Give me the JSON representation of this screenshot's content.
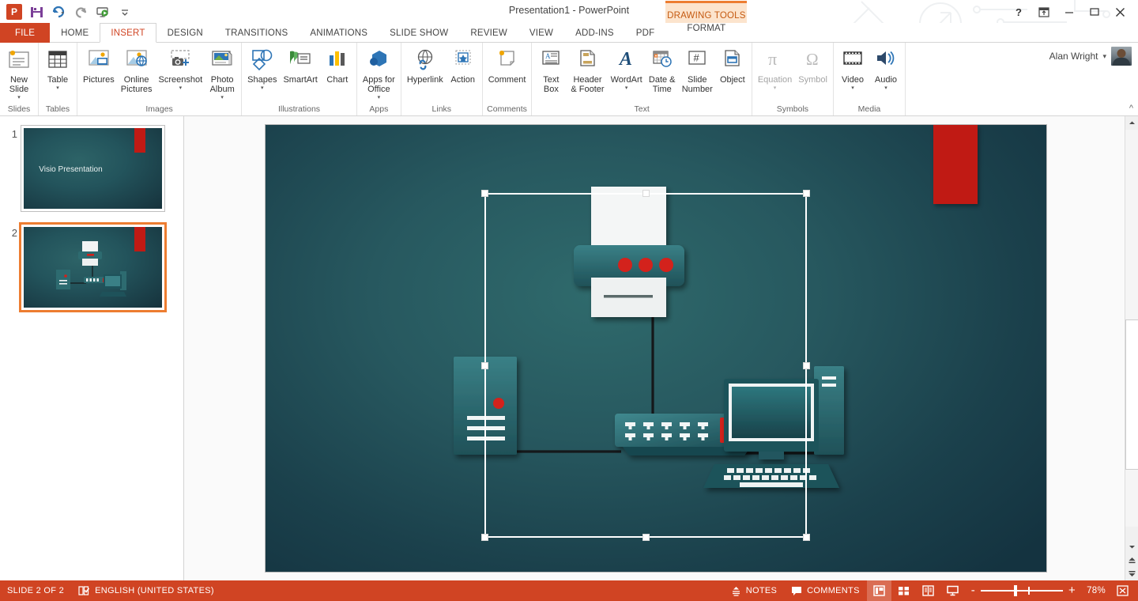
{
  "window": {
    "title": "Presentation1 - PowerPoint",
    "help_icon": "?",
    "ribbon_display_icon": "ribbon-display-options",
    "minimize_icon": "minimize",
    "maximize_icon": "maximize",
    "close_icon": "close"
  },
  "quick_access": {
    "app_logo": "P",
    "items": [
      {
        "name": "save-icon",
        "label": "Save"
      },
      {
        "name": "undo-icon",
        "label": "Undo"
      },
      {
        "name": "redo-icon",
        "label": "Redo"
      },
      {
        "name": "start-slideshow-icon",
        "label": "Start From Beginning"
      },
      {
        "name": "customize-qat-icon",
        "label": "Customize Quick Access Toolbar"
      }
    ]
  },
  "account": {
    "user_name": "Alan Wright",
    "dropdown_caret": "▾"
  },
  "contextual_tab_group": {
    "label": "DRAWING TOOLS",
    "tab": "FORMAT"
  },
  "tabs": [
    {
      "label": "FILE",
      "state": "file"
    },
    {
      "label": "HOME",
      "state": "normal"
    },
    {
      "label": "INSERT",
      "state": "active"
    },
    {
      "label": "DESIGN",
      "state": "normal"
    },
    {
      "label": "TRANSITIONS",
      "state": "normal"
    },
    {
      "label": "ANIMATIONS",
      "state": "normal"
    },
    {
      "label": "SLIDE SHOW",
      "state": "normal"
    },
    {
      "label": "REVIEW",
      "state": "normal"
    },
    {
      "label": "VIEW",
      "state": "normal"
    },
    {
      "label": "ADD-INS",
      "state": "normal"
    },
    {
      "label": "PDF",
      "state": "normal"
    }
  ],
  "ribbon": {
    "collapse_icon": "^",
    "groups": [
      {
        "label": "Slides",
        "buttons": [
          {
            "label": "New\nSlide",
            "icon": "new-slide-icon",
            "caret": true,
            "disabled": false
          }
        ]
      },
      {
        "label": "Tables",
        "buttons": [
          {
            "label": "Table",
            "icon": "table-icon",
            "caret": true,
            "disabled": false
          }
        ]
      },
      {
        "label": "Images",
        "buttons": [
          {
            "label": "Pictures",
            "icon": "pictures-icon",
            "caret": false,
            "disabled": false
          },
          {
            "label": "Online\nPictures",
            "icon": "online-pictures-icon",
            "caret": false,
            "disabled": false
          },
          {
            "label": "Screenshot",
            "icon": "screenshot-icon",
            "caret": true,
            "disabled": false
          },
          {
            "label": "Photo\nAlbum",
            "icon": "photo-album-icon",
            "caret": true,
            "disabled": false
          }
        ]
      },
      {
        "label": "Illustrations",
        "buttons": [
          {
            "label": "Shapes",
            "icon": "shapes-icon",
            "caret": true,
            "disabled": false
          },
          {
            "label": "SmartArt",
            "icon": "smartart-icon",
            "caret": false,
            "disabled": false
          },
          {
            "label": "Chart",
            "icon": "chart-icon",
            "caret": false,
            "disabled": false
          }
        ]
      },
      {
        "label": "Apps",
        "buttons": [
          {
            "label": "Apps for\nOffice",
            "icon": "apps-for-office-icon",
            "caret": true,
            "disabled": false
          }
        ]
      },
      {
        "label": "Links",
        "buttons": [
          {
            "label": "Hyperlink",
            "icon": "hyperlink-icon",
            "caret": false,
            "disabled": false
          },
          {
            "label": "Action",
            "icon": "action-icon",
            "caret": false,
            "disabled": false
          }
        ]
      },
      {
        "label": "Comments",
        "buttons": [
          {
            "label": "Comment",
            "icon": "comment-icon",
            "caret": false,
            "disabled": false
          }
        ]
      },
      {
        "label": "Text",
        "buttons": [
          {
            "label": "Text\nBox",
            "icon": "text-box-icon",
            "caret": false,
            "disabled": false
          },
          {
            "label": "Header\n& Footer",
            "icon": "header-footer-icon",
            "caret": false,
            "disabled": false
          },
          {
            "label": "WordArt",
            "icon": "wordart-icon",
            "caret": true,
            "disabled": false
          },
          {
            "label": "Date &\nTime",
            "icon": "date-time-icon",
            "caret": false,
            "disabled": false
          },
          {
            "label": "Slide\nNumber",
            "icon": "slide-number-icon",
            "caret": false,
            "disabled": false
          },
          {
            "label": "Object",
            "icon": "object-icon",
            "caret": false,
            "disabled": false
          }
        ]
      },
      {
        "label": "Symbols",
        "buttons": [
          {
            "label": "Equation",
            "icon": "equation-icon",
            "caret": true,
            "disabled": true
          },
          {
            "label": "Symbol",
            "icon": "symbol-icon",
            "caret": false,
            "disabled": true
          }
        ]
      },
      {
        "label": "Media",
        "buttons": [
          {
            "label": "Video",
            "icon": "video-icon",
            "caret": true,
            "disabled": false
          },
          {
            "label": "Audio",
            "icon": "audio-icon",
            "caret": true,
            "disabled": false
          }
        ]
      }
    ]
  },
  "slides_pane": {
    "slides": [
      {
        "number": "1",
        "title": "Visio Presentation",
        "selected": false,
        "kind": "title"
      },
      {
        "number": "2",
        "title": "",
        "selected": true,
        "kind": "diagram"
      }
    ]
  },
  "slide_canvas": {
    "selection": {
      "active": true,
      "handles": 8
    },
    "shapes": [
      {
        "name": "printer",
        "label": "Printer"
      },
      {
        "name": "network-switch",
        "label": "Network Switch"
      },
      {
        "name": "server-tower",
        "label": "Server"
      },
      {
        "name": "desktop-computer",
        "label": "Desktop PC"
      },
      {
        "name": "red-accent-bar",
        "label": "Accent Rectangle"
      }
    ],
    "colors": {
      "background_dark": "#143340",
      "background_light": "#2f6a6c",
      "accent_red": "#c01a14",
      "device_teal": "#2d6b70",
      "connector_black": "#15181a",
      "selection_white": "#ffffff"
    }
  },
  "status_bar": {
    "slide_indicator": "SLIDE 2 OF 2",
    "spellcheck_icon": "spellcheck-icon",
    "language": "ENGLISH (UNITED STATES)",
    "notes_label": "NOTES",
    "comments_label": "COMMENTS",
    "views": [
      {
        "name": "normal-view-button",
        "label": "Normal",
        "active": true
      },
      {
        "name": "slide-sorter-button",
        "label": "Slide Sorter",
        "active": false
      },
      {
        "name": "reading-view-button",
        "label": "Reading View",
        "active": false
      },
      {
        "name": "slideshow-button",
        "label": "Slide Show",
        "active": false
      }
    ],
    "zoom_out": "-",
    "zoom_in": "+",
    "zoom_level": "78%",
    "fit_slide_icon": "fit-to-window-icon"
  }
}
